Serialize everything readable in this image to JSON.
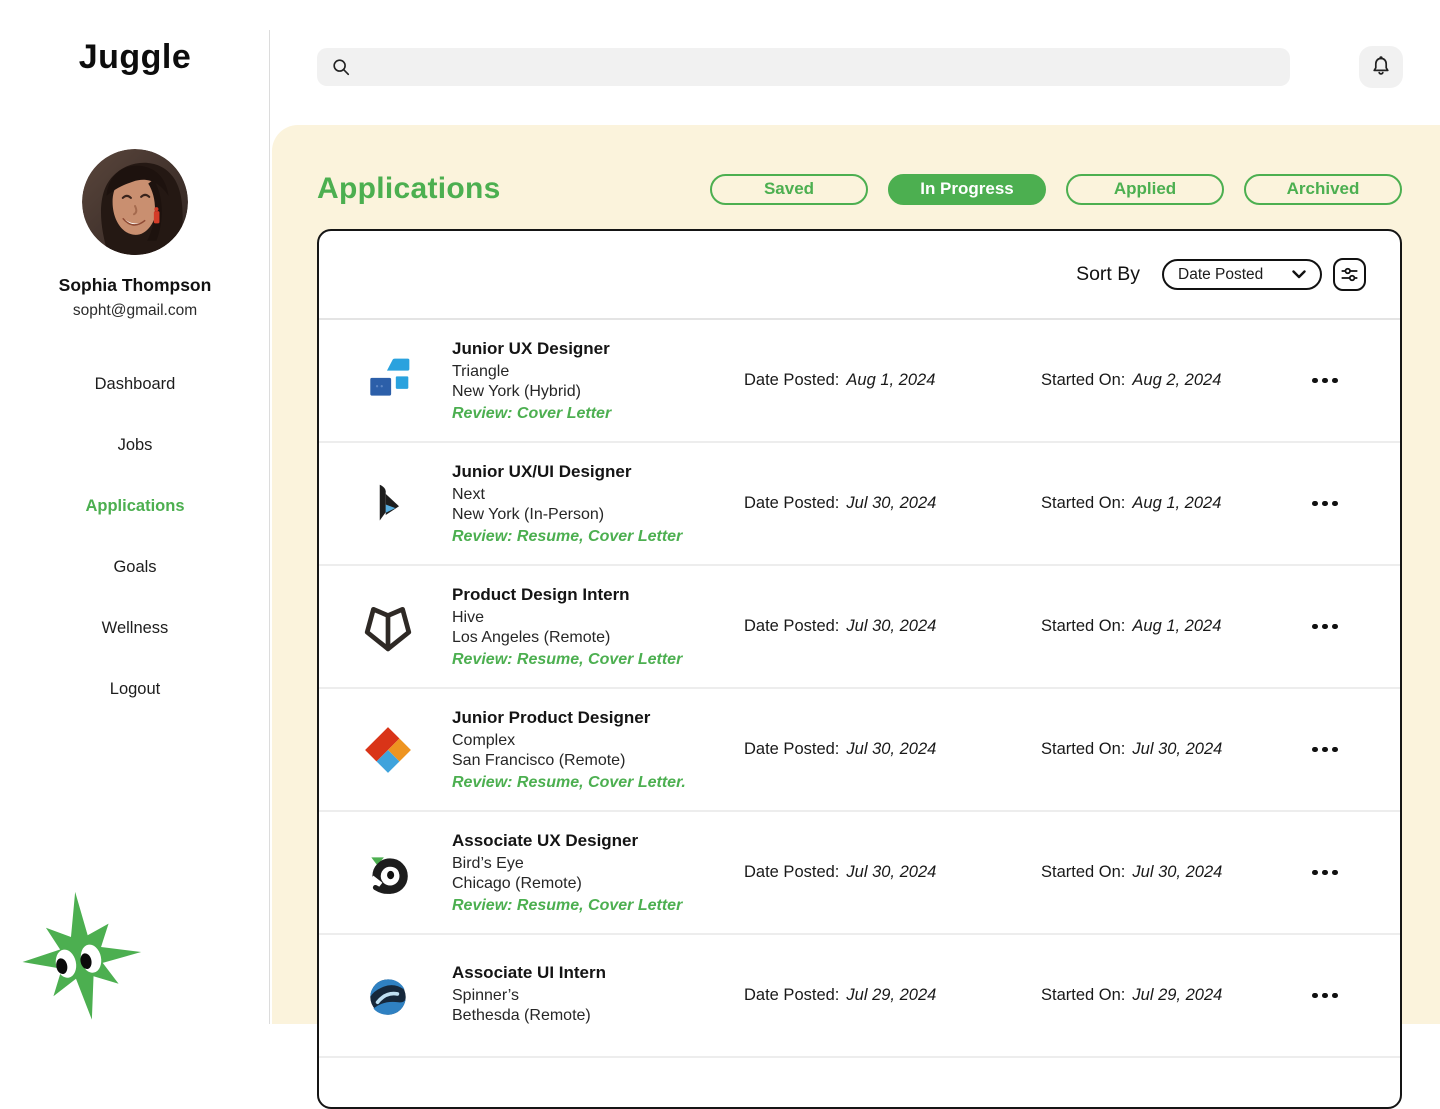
{
  "app": {
    "logo": "Juggle"
  },
  "colors": {
    "accent_green": "#4CAF50",
    "cream_background": "#FBF3DC",
    "card_border": "#151515"
  },
  "sidebar": {
    "user": {
      "name": "Sophia Thompson",
      "email": "sopht@gmail.com"
    },
    "items": [
      {
        "label": "Dashboard",
        "active": false
      },
      {
        "label": "Jobs",
        "active": false
      },
      {
        "label": "Applications",
        "active": true
      },
      {
        "label": "Goals",
        "active": false
      },
      {
        "label": "Wellness",
        "active": false
      },
      {
        "label": "Logout",
        "active": false
      }
    ],
    "mascot_icon": "green-star-mascot",
    "avatar_icon": "user-portrait"
  },
  "topbar": {
    "search_placeholder": "",
    "search_icon": "magnifier-icon",
    "bell_icon": "bell-icon"
  },
  "main": {
    "title": "Applications",
    "filters": [
      {
        "label": "Saved",
        "active": false
      },
      {
        "label": "In Progress",
        "active": true
      },
      {
        "label": "Applied",
        "active": false
      },
      {
        "label": "Archived",
        "active": false
      }
    ],
    "sort": {
      "label": "Sort By",
      "selected": "Date Posted",
      "chevron_icon": "chevron-down-icon",
      "filter_icon": "sliders-icon"
    }
  },
  "table": {
    "date_posted_label": "Date Posted:",
    "started_on_label": "Started On:",
    "row_menu_icon": "ellipsis-icon",
    "rows": [
      {
        "logo": "triangle-logo",
        "title": "Junior UX Designer",
        "company": "Triangle",
        "location": "New York (Hybrid)",
        "review": "Review: Cover Letter",
        "date_posted": "Aug 1, 2024",
        "started_on": "Aug 2, 2024"
      },
      {
        "logo": "next-logo",
        "title": "Junior UX/UI Designer",
        "company": "Next",
        "location": "New York (In-Person)",
        "review": "Review: Resume, Cover Letter",
        "date_posted": "Jul 30, 2024",
        "started_on": "Aug 1, 2024"
      },
      {
        "logo": "hive-logo",
        "title": "Product Design Intern",
        "company": "Hive",
        "location": "Los Angeles (Remote)",
        "review": "Review: Resume, Cover Letter",
        "date_posted": "Jul 30, 2024",
        "started_on": "Aug 1, 2024"
      },
      {
        "logo": "complex-logo",
        "title": "Junior Product Designer",
        "company": "Complex",
        "location": "San Francisco (Remote)",
        "review": "Review: Resume, Cover Letter.",
        "date_posted": "Jul 30, 2024",
        "started_on": "Jul 30, 2024"
      },
      {
        "logo": "birds-eye-logo",
        "title": "Associate UX Designer",
        "company": "Bird’s Eye",
        "location": "Chicago (Remote)",
        "review": "Review: Resume, Cover Letter",
        "date_posted": "Jul 30, 2024",
        "started_on": "Jul 30, 2024"
      },
      {
        "logo": "spinners-logo",
        "title": "Associate UI Intern",
        "company": "Spinner’s",
        "location": "Bethesda (Remote)",
        "review": "",
        "date_posted": "Jul 29, 2024",
        "started_on": "Jul 29, 2024"
      }
    ]
  }
}
